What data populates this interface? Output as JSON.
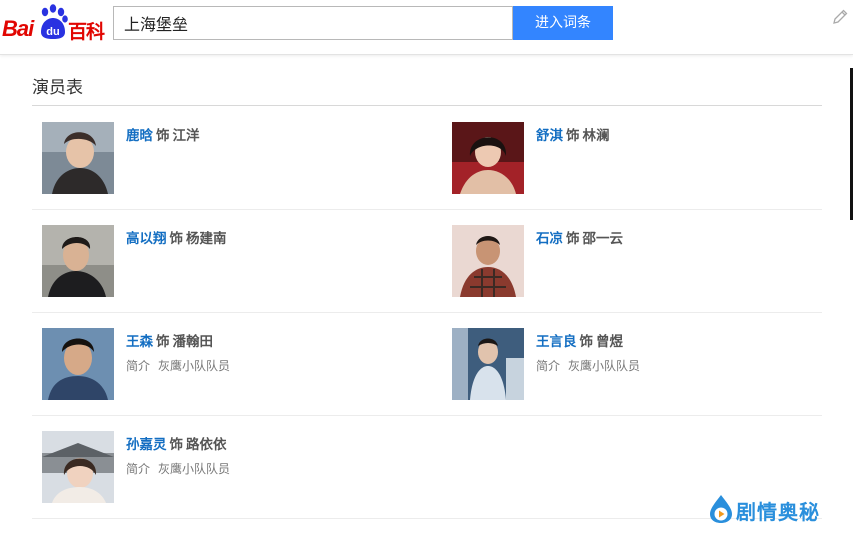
{
  "header": {
    "logo_bai": "Bai",
    "logo_du": "du",
    "logo_baike": "百科",
    "search_value": "上海堡垒",
    "enter_button": "进入词条"
  },
  "section": {
    "title": "演员表"
  },
  "cast": [
    {
      "actor": "鹿晗",
      "as": "饰",
      "role": "江洋"
    },
    {
      "actor": "舒淇",
      "as": "饰",
      "role": "林澜"
    },
    {
      "actor": "高以翔",
      "as": "饰",
      "role": "杨建南"
    },
    {
      "actor": "石凉",
      "as": "饰",
      "role": "邵一云"
    },
    {
      "actor": "王森",
      "as": "饰",
      "role": "潘翰田",
      "intro_label": "简介",
      "intro": "灰鹰小队队员"
    },
    {
      "actor": "王言良",
      "as": "饰",
      "role": "曾煜",
      "intro_label": "简介",
      "intro": "灰鹰小队队员"
    },
    {
      "actor": "孙嘉灵",
      "as": "饰",
      "role": "路依依",
      "intro_label": "简介",
      "intro": "灰鹰小队队员"
    }
  ],
  "watermark": {
    "text": "剧情奥秘"
  },
  "colors": {
    "accent": "#3385ff",
    "link": "#136ec2",
    "logo_red": "#e10602"
  }
}
